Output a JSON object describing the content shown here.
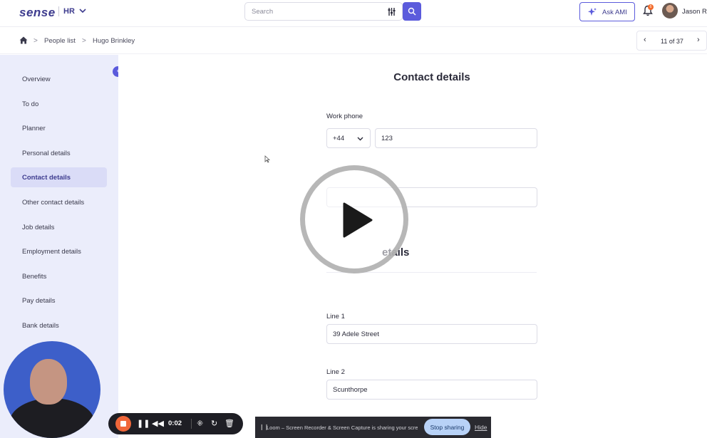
{
  "header": {
    "logo_text": "sense",
    "product": "HR",
    "search_placeholder": "Search",
    "ask_button": "Ask AMI",
    "notification_count": "6",
    "user_name": "Jason Ro"
  },
  "breadcrumb": {
    "items": [
      "People list",
      "Hugo Brinkley"
    ],
    "separator": ">"
  },
  "pager": {
    "prev": "‹",
    "label": "11 of 37",
    "next": "›"
  },
  "sidebar": {
    "items": [
      {
        "label": "Overview"
      },
      {
        "label": "To do"
      },
      {
        "label": "Planner"
      },
      {
        "label": "Personal details"
      },
      {
        "label": "Contact details",
        "active": true
      },
      {
        "label": "Other contact details"
      },
      {
        "label": "Job details"
      },
      {
        "label": "Employment details"
      },
      {
        "label": "Benefits"
      },
      {
        "label": "Pay details"
      },
      {
        "label": "Bank details"
      }
    ]
  },
  "main": {
    "title": "Contact details",
    "work_phone": {
      "label": "Work phone",
      "country_code": "+44",
      "number": "123"
    },
    "section_partial": "etails",
    "address": {
      "line1": {
        "label": "Line 1",
        "value": "39 Adele Street"
      },
      "line2": {
        "label": "Line 2",
        "value": "Scunthorpe"
      }
    }
  },
  "recorder": {
    "timer": "0:02",
    "share_message": "Loom – Screen Recorder & Screen Capture is sharing your screen.",
    "stop_sharing": "Stop sharing",
    "hide": "Hide"
  },
  "colors": {
    "accent": "#5b5bdc",
    "brand": "#3d3b8e",
    "sidebar_bg": "#ebedfb",
    "record": "#f0673a"
  }
}
